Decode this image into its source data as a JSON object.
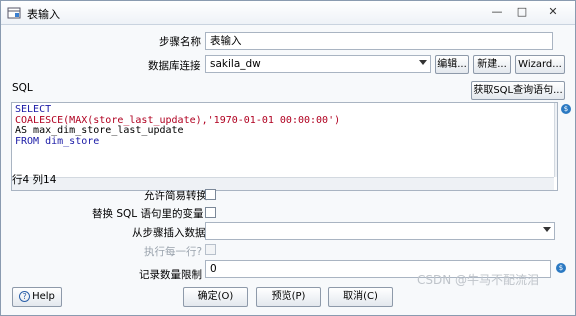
{
  "window": {
    "title": "表输入",
    "minimize": "—",
    "restore": "□",
    "close": "✕"
  },
  "step_name": {
    "label": "步骤名称",
    "value": "表输入"
  },
  "connection": {
    "label": "数据库连接",
    "value": "sakila_dw",
    "edit": "编辑...",
    "new": "新建...",
    "wizard": "Wizard..."
  },
  "sql": {
    "label": "SQL",
    "get_sql_button": "获取SQL查询语句...",
    "lines": [
      "SELECT",
      "COALESCE(MAX(store_last_update),'1970-01-01 00:00:00')",
      "AS max_dim_store_last_update",
      "FROM dim_store"
    ],
    "position": "行4 列14"
  },
  "options": {
    "lazy_conversion": "允许简易转换",
    "replace_vars": "替换 SQL 语句里的变量",
    "insert_from_step": "从步骤插入数据",
    "execute_each_row": "执行每一行?",
    "row_limit_label": "记录数量限制",
    "row_limit_value": "0"
  },
  "buttons": {
    "help": "Help",
    "ok": "确定(O)",
    "preview": "预览(P)",
    "cancel": "取消(C)"
  },
  "watermark": "CSDN @牛马不配流泪",
  "colors": {
    "sql_keyword": "#1a1aa6",
    "sql_function": "#b00020",
    "sql_string": "#a0147a",
    "info_icon": "#2b79c2"
  }
}
